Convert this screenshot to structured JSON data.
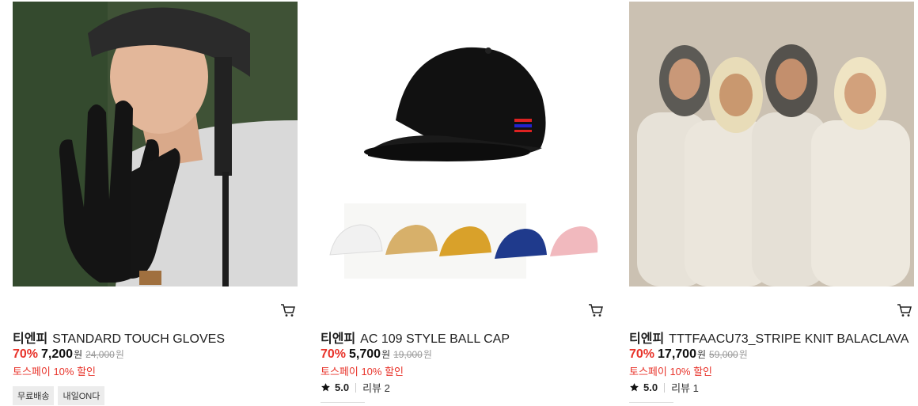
{
  "products": [
    {
      "brand": "티엔피",
      "name": "STANDARD TOUCH GLOVES",
      "discount": "70%",
      "price": "7,200",
      "won": "원",
      "original_price": "24,000",
      "promo": "토스페이 10% 할인",
      "tags": [
        "무료배송",
        "내일ON다"
      ],
      "image_icon": "gloves-photo"
    },
    {
      "brand": "티엔피",
      "name": "AC 109 STYLE BALL CAP",
      "discount": "70%",
      "price": "5,700",
      "won": "원",
      "original_price": "19,000",
      "promo": "토스페이 10% 할인",
      "rating": "5.0",
      "review": "리뷰 2",
      "image_icon": "ball-cap-photo"
    },
    {
      "brand": "티엔피",
      "name": "TTTFAACU73_STRIPE KNIT BALACLAVA",
      "discount": "70%",
      "price": "17,700",
      "won": "원",
      "original_price": "59,000",
      "promo": "토스페이 10% 할인",
      "rating": "5.0",
      "review": "리뷰 1",
      "image_icon": "balaclava-photo"
    }
  ],
  "colors": {
    "accent_red": "#e8332a",
    "tag_bg": "#ececec"
  }
}
